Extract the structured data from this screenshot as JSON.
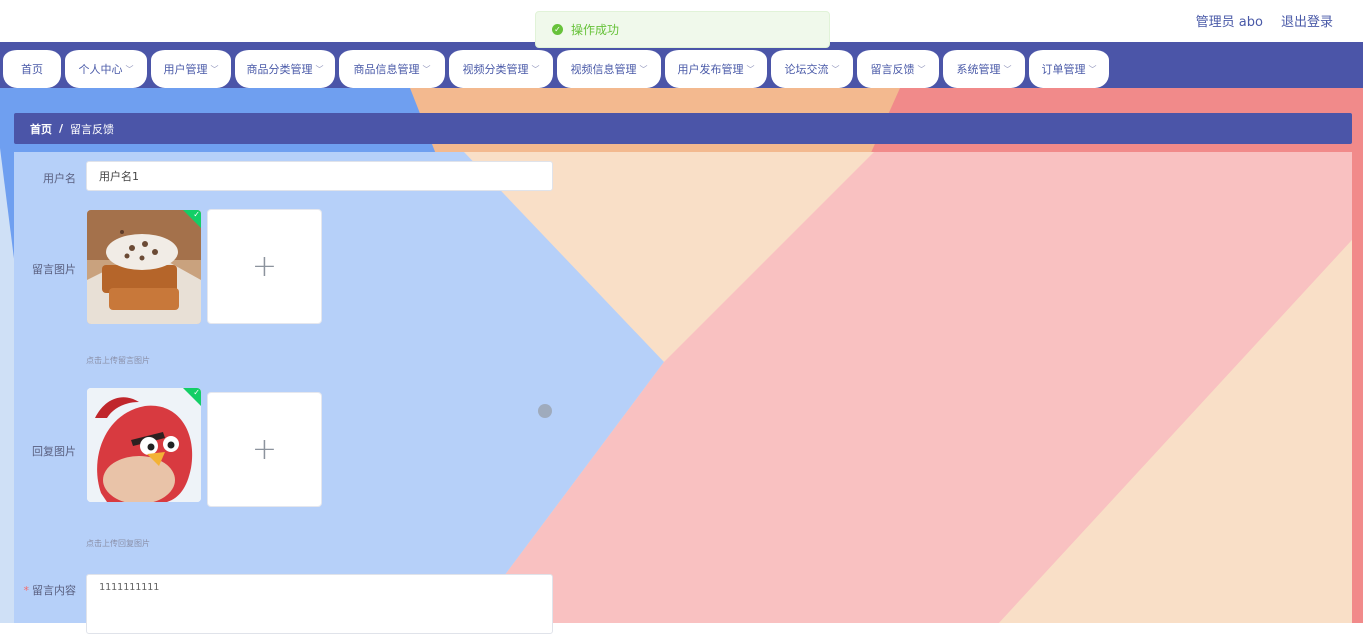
{
  "header": {
    "user_label": "管理员 abo",
    "logout_label": "退出登录"
  },
  "toast": {
    "message": "操作成功",
    "icon": "check-circle-icon",
    "color": "#67c23a"
  },
  "nav": {
    "items": [
      {
        "label": "首页",
        "dropdown": false
      },
      {
        "label": "个人中心",
        "dropdown": true
      },
      {
        "label": "用户管理",
        "dropdown": true
      },
      {
        "label": "商品分类管理",
        "dropdown": true
      },
      {
        "label": "商品信息管理",
        "dropdown": true
      },
      {
        "label": "视频分类管理",
        "dropdown": true
      },
      {
        "label": "视频信息管理",
        "dropdown": true
      },
      {
        "label": "用户发布管理",
        "dropdown": true
      },
      {
        "label": "论坛交流",
        "dropdown": true
      },
      {
        "label": "留言反馈",
        "dropdown": true
      },
      {
        "label": "系统管理",
        "dropdown": true
      },
      {
        "label": "订单管理",
        "dropdown": true
      }
    ]
  },
  "breadcrumb": {
    "home": "首页",
    "separator": "/",
    "current": "留言反馈"
  },
  "form": {
    "username": {
      "label": "用户名",
      "value": "用户名1"
    },
    "message_image": {
      "label": "留言图片",
      "hint": "点击上传留言图片",
      "image": "cake-photo"
    },
    "reply_image": {
      "label": "回复图片",
      "hint": "点击上传回复图片",
      "image": "red-bird-cartoon"
    },
    "content": {
      "label": "留言内容",
      "required_mark": "*",
      "value": "1111111111"
    },
    "upload_plus": "+"
  },
  "colors": {
    "primary": "#4b55a8",
    "success": "#13ce66"
  }
}
